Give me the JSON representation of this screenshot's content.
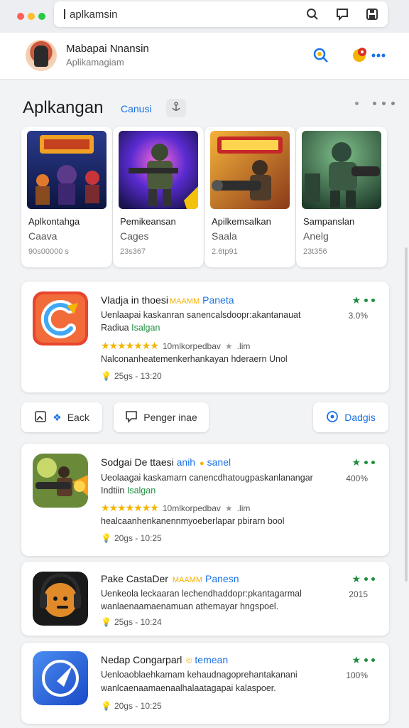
{
  "browser": {
    "url_text": "aplkamsin",
    "icons": [
      "search-icon",
      "comment-icon",
      "save-icon"
    ]
  },
  "profile": {
    "name": "Mabapai Nnansin",
    "subtitle": "Aplikamagiam"
  },
  "section": {
    "title": "Aplkangan",
    "tab": "Canusi"
  },
  "games": [
    {
      "title": "Aplkontahga",
      "category": "Caava",
      "count": "90s00000 s"
    },
    {
      "title": "Pemikeansan",
      "category": "Cages",
      "count": "23s367"
    },
    {
      "title": "Apilkemsalkan",
      "category": "Saala",
      "count": "2.6tp91"
    },
    {
      "title": "Sampanslan",
      "category": "Anelg",
      "count": "23t356"
    }
  ],
  "apps": [
    {
      "title": "Vladja in thoesi",
      "badge": "MAAMM",
      "accent": "Paneta",
      "desc": "Uenlaapai kaskanran sanencalsdoopr:akantanauat",
      "tag_prefix": "Radiua",
      "tag_green": "Isalgan",
      "rating_text": "10mlkorpedbav",
      "rating_extra": ".lim",
      "line": "Nalconanheatemenkerhankayan hderaern Unol",
      "meta": "25gs - 13:20",
      "percent": "3.0%"
    },
    {
      "title": "Sodgai De ttaesi",
      "badge": "anih",
      "accent": "sanel",
      "desc": "Ueolaagai kaskamarn canencdhatougpaskanlanangar",
      "tag_prefix": "Indtiin",
      "tag_green": "Isalgan",
      "rating_text": "10mlkorpedbav",
      "rating_extra": ".lim",
      "line": "healcaanhenkanennmyoeberlapar pbirarn bool",
      "meta": "20gs - 10:25",
      "percent": "400%"
    },
    {
      "title": "Pake CastaDer",
      "badge": "MAAMM",
      "accent": "Panesn",
      "desc": "Uenkeola leckaaran lechendhaddopr:pkantagarmal",
      "line2": "wanlaenaamaenamuan athemayar hngspoel.",
      "meta": "25gs - 10:24",
      "percent": "2015"
    },
    {
      "title": "Nedap Congarparl",
      "badge": "",
      "accent": "temean",
      "desc": "Uenloaoblaehkamam kehaudnagoprehantakanani",
      "line2": "wanlcaenaamaenaalhalaatagapai kalaspoer.",
      "meta": "20gs - 10:25",
      "percent": "100%"
    }
  ],
  "actions": {
    "back": "Eack",
    "middle": "Penger inae",
    "right": "Dadgis"
  },
  "colors": {
    "accent": "#1a73e8",
    "green": "#1e8e3e",
    "star": "#f4b400"
  }
}
